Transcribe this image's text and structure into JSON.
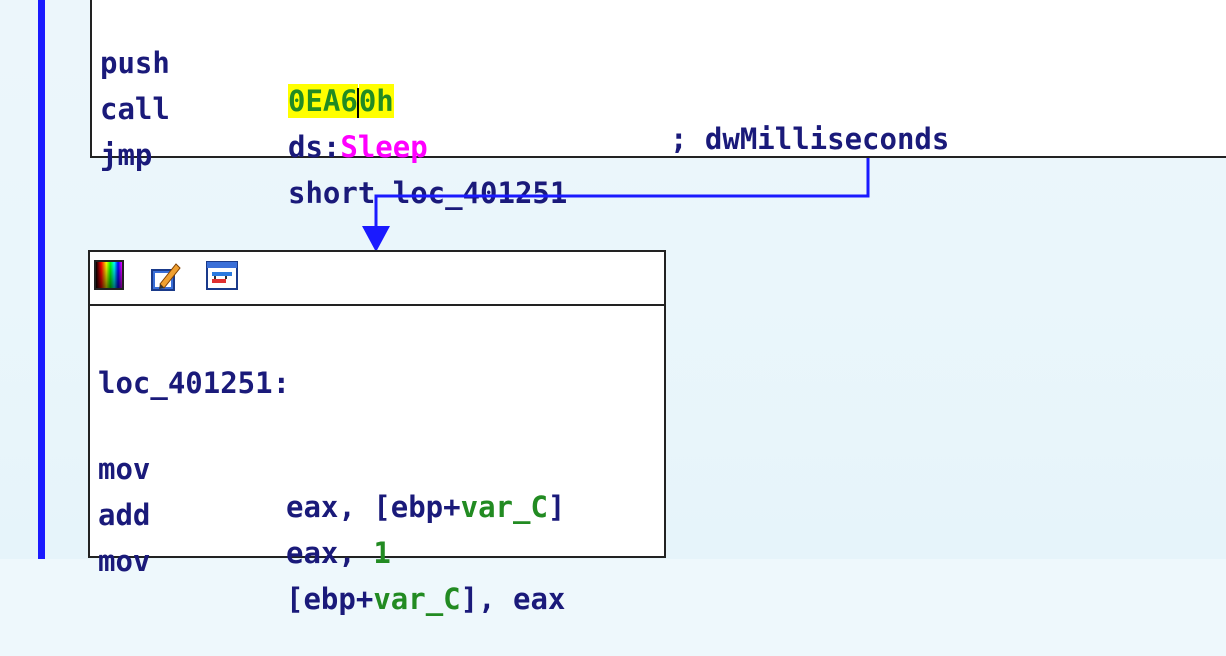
{
  "top_block": {
    "lines": [
      {
        "mnemonic": "push",
        "operand_hex_a": "0EA6",
        "operand_hex_b": "0h",
        "comment": "; dwMilliseconds"
      },
      {
        "mnemonic": "call",
        "operand_prefix": "ds:",
        "operand_func": "Sleep"
      },
      {
        "mnemonic": "jmp",
        "operand": "short loc_401251"
      }
    ]
  },
  "bottom_block": {
    "toolbar_icons": [
      "color-palette-icon",
      "edit-pencil-icon",
      "graph-view-icon"
    ],
    "label": "loc_401251:",
    "lines": [
      {
        "mnemonic": "mov",
        "op_a": "eax, [ebp+",
        "op_var": "var_C",
        "op_b": "]"
      },
      {
        "mnemonic": "add",
        "op_a": "eax, ",
        "op_num": "1"
      },
      {
        "mnemonic": "mov",
        "op_a": "[ebp+",
        "op_var": "var_C",
        "op_b": "], eax"
      }
    ]
  },
  "colors": {
    "background": "#eef8fc",
    "code_text": "#1a1a7a",
    "api_name": "#ff00ff",
    "variable": "#228b22",
    "highlight": "#ffff00",
    "flow_edge": "#1a1aff"
  }
}
